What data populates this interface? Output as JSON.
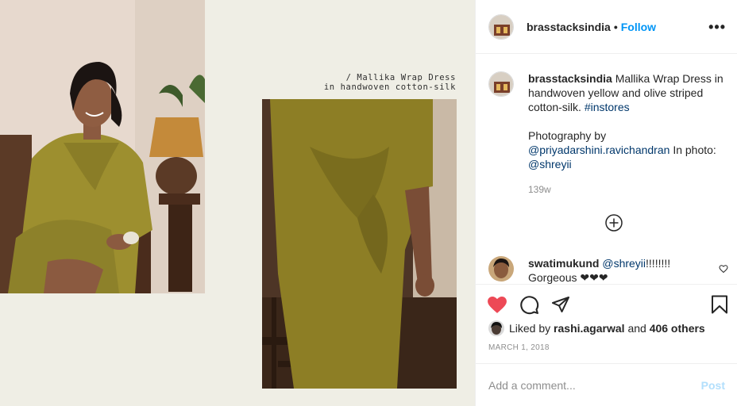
{
  "photo": {
    "caption_line1": "/ Mallika Wrap Dress",
    "caption_line2": "in handwoven cotton-silk"
  },
  "header": {
    "username": "brasstacksindia",
    "separator": "•",
    "follow_label": "Follow",
    "more_label": "•••"
  },
  "caption": {
    "username": "brasstacksindia",
    "text": "Mallika Wrap Dress in handwoven yellow and olive striped cotton-silk.",
    "hashtag": "#instores",
    "photo_credit_prefix": "Photography by",
    "photographer": "@priyadarshini.ravichandran",
    "in_photo_label": "In photo:",
    "model": "@shreyii",
    "time_ago": "139w"
  },
  "comment": {
    "username": "swatimukund",
    "mention": "@shreyii",
    "text_after_mention": "!!!!!!!!",
    "second_line": "Gorgeous ❤❤❤"
  },
  "actions": {
    "liked_by_prefix": "Liked by",
    "liked_by_user": "rashi.agarwal",
    "and_label": "and",
    "others": "406 others",
    "date": "MARCH 1, 2018"
  },
  "add_comment": {
    "placeholder": "Add a comment...",
    "post_label": "Post"
  },
  "colors": {
    "accent_blue": "#0095f6",
    "link_blue": "#00376b",
    "liked_red": "#ed4956",
    "muted_gray": "#8e8e8e",
    "post_disabled": "#b2dffc",
    "panel_cream": "#efeee5"
  },
  "icons": [
    "more-icon",
    "add-circle-icon",
    "heart-filled-icon",
    "comment-icon",
    "share-icon",
    "bookmark-icon",
    "heart-outline-icon"
  ]
}
